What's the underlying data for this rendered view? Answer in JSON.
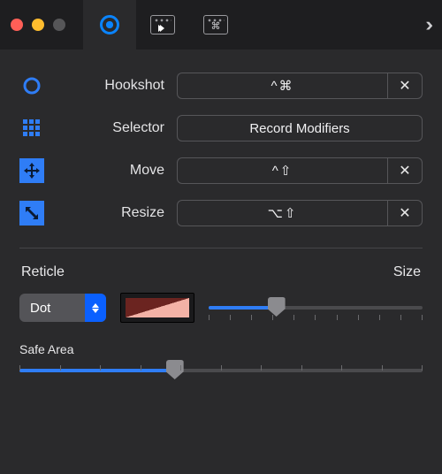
{
  "tabs": {
    "overflow_glyph": "››"
  },
  "shortcuts": {
    "hookshot": {
      "label": "Hookshot",
      "keys": "^⌘",
      "clear": "✕"
    },
    "selector": {
      "label": "Selector",
      "keys": "Record Modifiers"
    },
    "move": {
      "label": "Move",
      "keys": "^⇧",
      "clear": "✕"
    },
    "resize": {
      "label": "Resize",
      "keys": "⌥⇧",
      "clear": "✕"
    }
  },
  "reticle": {
    "heading": "Reticle",
    "size_heading": "Size",
    "style": "Dot",
    "color": "#6b2420",
    "size_value": 30,
    "size_min": 0,
    "size_max": 100
  },
  "safe_area": {
    "heading": "Safe Area",
    "value": 38,
    "min": 0,
    "max": 100
  }
}
